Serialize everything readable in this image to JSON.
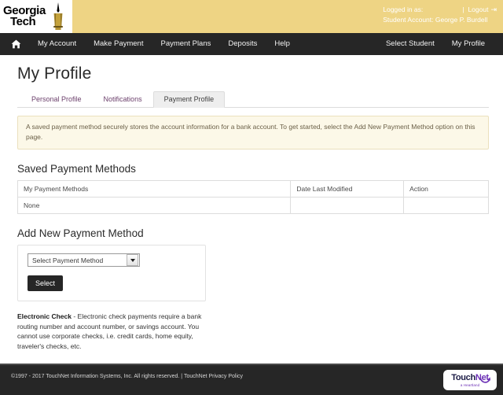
{
  "header": {
    "logo_line1": "Georgia",
    "logo_line2": "Tech",
    "logo_icon": "georgia-tech-tower-icon",
    "logged_in_label": "Logged in as:",
    "separator": "|",
    "logout_label": "Logout",
    "logout_icon": "logout-arrow-icon",
    "account_line": "Student Account: George P. Burdell"
  },
  "nav": {
    "home_icon": "home-icon",
    "left_items": [
      {
        "label": "My Account"
      },
      {
        "label": "Make Payment"
      },
      {
        "label": "Payment Plans"
      },
      {
        "label": "Deposits"
      },
      {
        "label": "Help"
      }
    ],
    "right_items": [
      {
        "label": "Select Student"
      },
      {
        "label": "My Profile"
      }
    ]
  },
  "main": {
    "page_title": "My Profile",
    "tabs": [
      {
        "label": "Personal Profile",
        "active": false
      },
      {
        "label": "Notifications",
        "active": false
      },
      {
        "label": "Payment Profile",
        "active": true
      }
    ],
    "alert_text": "A saved payment method securely stores the account information for a bank account. To get started, select the Add New Payment Method option on this page.",
    "saved_methods": {
      "heading": "Saved Payment Methods",
      "columns": [
        "My Payment Methods",
        "Date Last Modified",
        "Action"
      ],
      "rows": [
        {
          "method": "None",
          "date": "",
          "action": ""
        }
      ]
    },
    "add_method": {
      "heading": "Add New Payment Method",
      "select_value": "Select Payment Method",
      "select_icon": "chevron-down-icon",
      "button_label": "Select"
    },
    "description": {
      "term": "Electronic Check",
      "body": " - Electronic check payments require a bank routing number and account number, or savings account. You cannot use corporate checks, i.e. credit cards, home equity, traveler's checks, etc."
    }
  },
  "footer": {
    "copyright": "©1997 - 2017  TouchNet Information Systems, Inc. All rights reserved. |",
    "privacy_link": "TouchNet Privacy Policy",
    "logo_touch": "Touch",
    "logo_net": "Net",
    "logo_sub": "a Heartland",
    "logo_icon": "touchnet-logo"
  },
  "colors": {
    "gold": "#eed484",
    "nav_dark": "#262626",
    "tab_link": "#6b3f6b",
    "alert_bg": "#fcf8e8",
    "alert_border": "#ebe0bd",
    "brand_purple": "#6b2fb5",
    "brand_navy": "#1b1b45"
  }
}
